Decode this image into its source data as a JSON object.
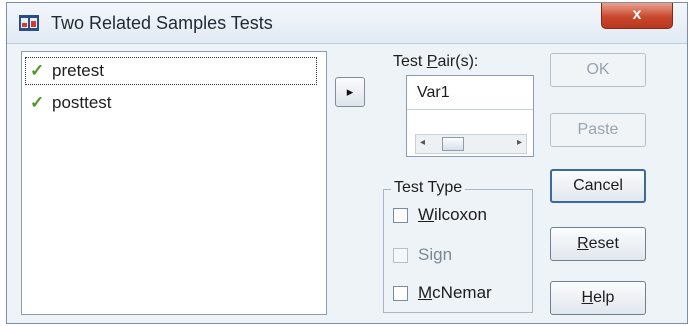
{
  "window": {
    "title": "Two Related Samples Tests",
    "close_label": "x"
  },
  "variables": {
    "items": [
      {
        "label": "pretest"
      },
      {
        "label": "posttest"
      }
    ]
  },
  "arrow_glyph": "▸",
  "test_pairs": {
    "label_prefix": "Test ",
    "label_underlined": "P",
    "label_suffix": "air(s):",
    "value": "Var1"
  },
  "test_type": {
    "label": "Test Type",
    "options": [
      {
        "accel": "W",
        "rest": "ilcoxon",
        "checked": false,
        "enabled": true
      },
      {
        "accel": "",
        "rest": "Sign",
        "checked": false,
        "enabled": false
      },
      {
        "accel": "M",
        "rest": "cNemar",
        "checked": false,
        "enabled": true
      }
    ]
  },
  "buttons": {
    "ok": "OK",
    "paste": "Paste",
    "cancel": "Cancel",
    "reset_accel": "R",
    "reset_rest": "eset",
    "help_accel": "H",
    "help_rest": "elp"
  },
  "colors": {
    "check_icon": "#4a9a24",
    "close_button": "#c9482c"
  }
}
